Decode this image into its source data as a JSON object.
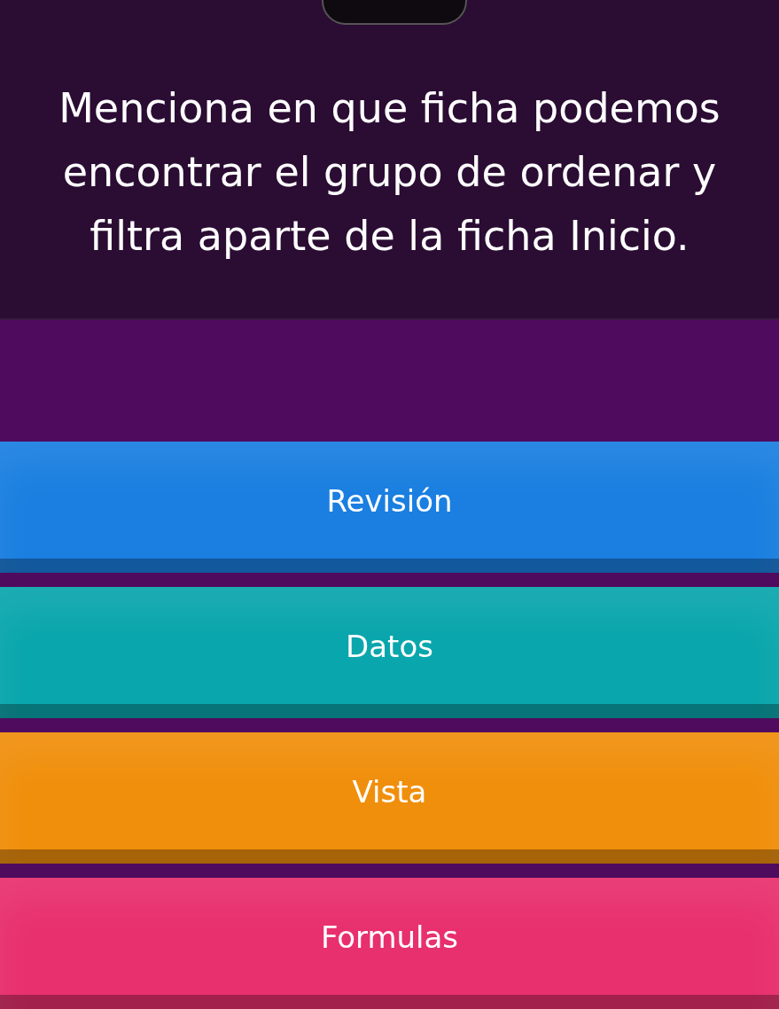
{
  "question": {
    "text": "Menciona en que ficha podemos encontrar el grupo de ordenar y filtra aparte de la ficha Inicio."
  },
  "options": [
    {
      "label": "Revisión",
      "color": "#1a7fe0"
    },
    {
      "label": "Datos",
      "color": "#0aa6ad"
    },
    {
      "label": "Vista",
      "color": "#f08f0c"
    },
    {
      "label": "Formulas",
      "color": "#e8306e"
    }
  ]
}
